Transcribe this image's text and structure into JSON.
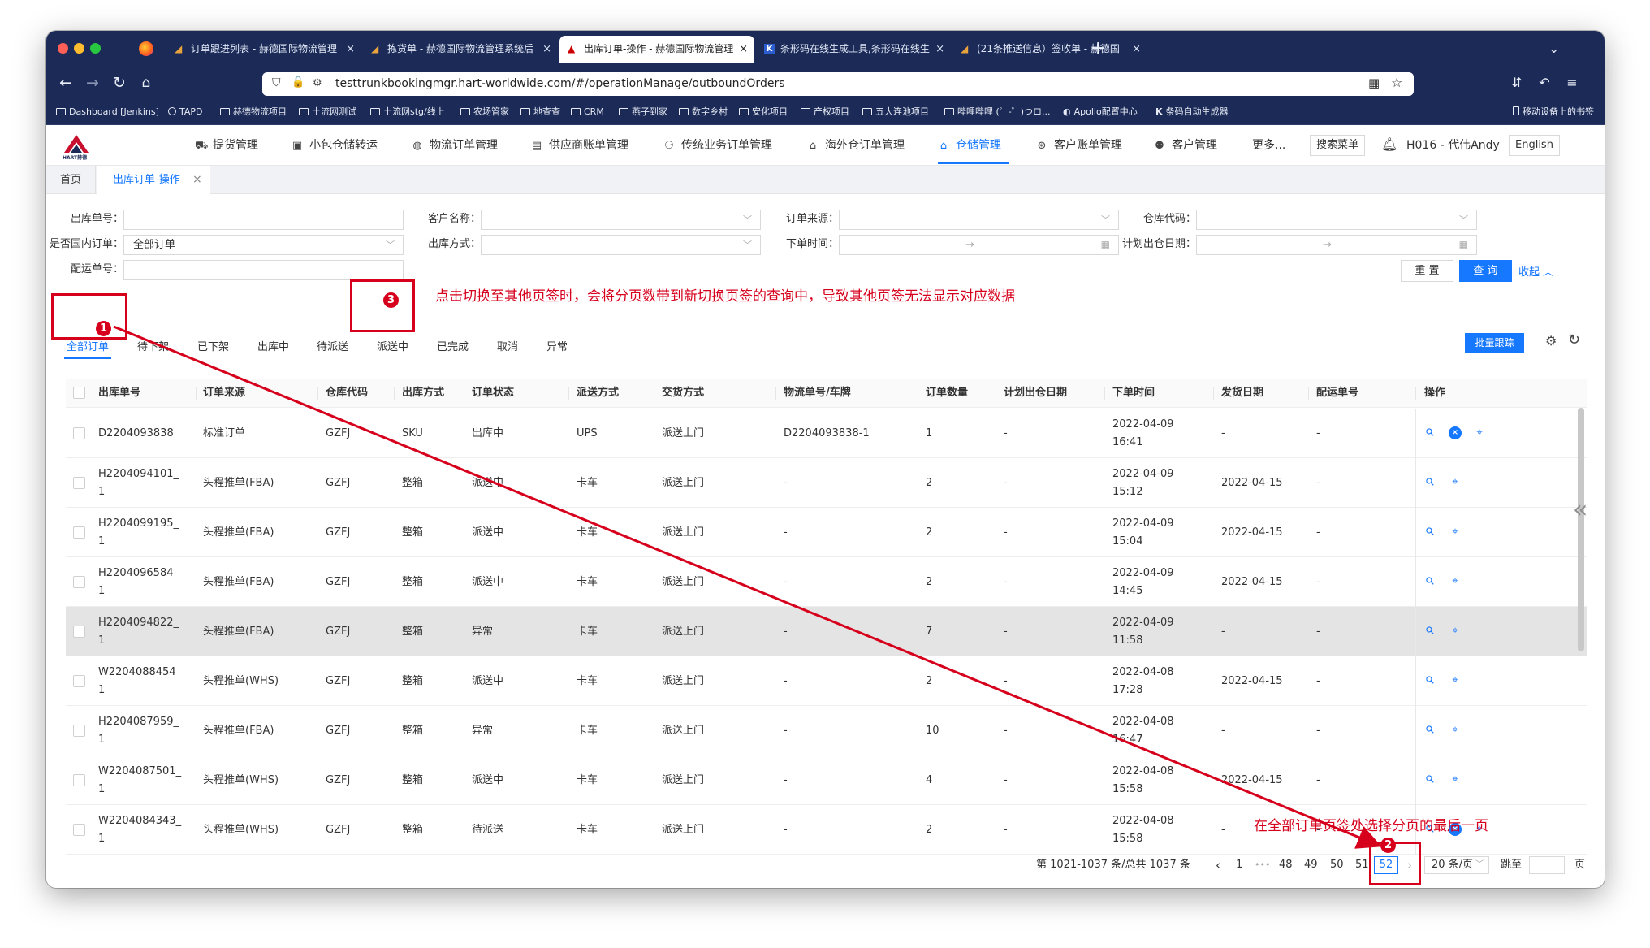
{
  "browser": {
    "tabs": [
      {
        "title": "订单跟进列表 - 赫德国际物流管理"
      },
      {
        "title": "拣货单 - 赫德国际物流管理系统后"
      },
      {
        "title": "出库订单-操作 - 赫德国际物流管理"
      },
      {
        "title": "条形码在线生成工具,条形码在线生"
      },
      {
        "title": "(21条推送信息）签收单 - 赫德国"
      }
    ],
    "url": "testtrunkbookingmgr.hart-worldwide.com/#/operationManage/outboundOrders",
    "bookmarks": [
      "Dashboard [Jenkins]",
      "TAPD",
      "赫德物流项目",
      "土流网测试",
      "土流网stg/线上",
      "农场管家",
      "地查查",
      "CRM",
      "燕子到家",
      "数字乡村",
      "安化项目",
      "产权项目",
      "五大连池项目",
      "哔哩哔哩 (゜-゜)つロ...",
      "Apollo配置中心",
      "条码自动生成器"
    ],
    "bookmarks_right": "移动设备上的书签"
  },
  "app": {
    "logo_text": "HART赫德",
    "menu": [
      "提货管理",
      "小包仓储转运",
      "物流订单管理",
      "供应商账单管理",
      "传统业务订单管理",
      "海外仓订单管理",
      "仓储管理",
      "客户账单管理",
      "客户管理"
    ],
    "more": "更多...",
    "search_menu": "搜索菜单",
    "user": "H016 - 代伟Andy",
    "language": "English"
  },
  "page_tabs": {
    "home": "首页",
    "current": "出库订单-操作"
  },
  "filters": {
    "outbound_no_label": "出库单号：",
    "customer_label": "客户名称：",
    "order_source_label": "订单来源：",
    "warehouse_label": "仓库代码：",
    "domestic_label": "是否国内订单：",
    "domestic_value": "全部订单",
    "outbound_method_label": "出库方式：",
    "order_time_label": "下单时间：",
    "plan_date_label": "计划出仓日期：",
    "delivery_no_label": "配运单号：",
    "range_arrow": "→",
    "reset": "重 置",
    "query": "查 询",
    "collapse": "收起"
  },
  "status_tabs": [
    "全部订单",
    "待下架",
    "已下架",
    "出库中",
    "待派送",
    "派送中",
    "已完成",
    "取消",
    "异常"
  ],
  "batch_track": "批量跟踪",
  "table": {
    "columns": [
      "出库单号",
      "订单来源",
      "仓库代码",
      "出库方式",
      "订单状态",
      "派送方式",
      "交货方式",
      "物流单号/车牌",
      "订单数量",
      "计划出仓日期",
      "下单时间",
      "发货日期",
      "配运单号",
      "操作"
    ],
    "rows": [
      {
        "no1": "D2204093838",
        "no2": "",
        "source": "标准订单",
        "wh": "GZFJ",
        "method": "SKU",
        "status": "出库中",
        "delivery": "UPS",
        "handover": "派送上门",
        "tracking": "D2204093838-1",
        "qty": "1",
        "plan": "-",
        "date1": "2022-04-09",
        "date2": "16:41",
        "ship": "-",
        "dist": "-"
      },
      {
        "no1": "H2204094101_",
        "no2": "1",
        "source": "头程推单(FBA)",
        "wh": "GZFJ",
        "method": "整箱",
        "status": "派送中",
        "delivery": "卡车",
        "handover": "派送上门",
        "tracking": "-",
        "qty": "2",
        "plan": "-",
        "date1": "2022-04-09",
        "date2": "15:12",
        "ship": "2022-04-15",
        "dist": "-"
      },
      {
        "no1": "H2204099195_",
        "no2": "1",
        "source": "头程推单(FBA)",
        "wh": "GZFJ",
        "method": "整箱",
        "status": "派送中",
        "delivery": "卡车",
        "handover": "派送上门",
        "tracking": "-",
        "qty": "2",
        "plan": "-",
        "date1": "2022-04-09",
        "date2": "15:04",
        "ship": "2022-04-15",
        "dist": "-"
      },
      {
        "no1": "H2204096584_",
        "no2": "1",
        "source": "头程推单(FBA)",
        "wh": "GZFJ",
        "method": "整箱",
        "status": "派送中",
        "delivery": "卡车",
        "handover": "派送上门",
        "tracking": "-",
        "qty": "2",
        "plan": "-",
        "date1": "2022-04-09",
        "date2": "14:45",
        "ship": "2022-04-15",
        "dist": "-"
      },
      {
        "no1": "H2204094822_",
        "no2": "1",
        "source": "头程推单(FBA)",
        "wh": "GZFJ",
        "method": "整箱",
        "status": "异常",
        "delivery": "卡车",
        "handover": "派送上门",
        "tracking": "-",
        "qty": "7",
        "plan": "-",
        "date1": "2022-04-09",
        "date2": "11:58",
        "ship": "-",
        "dist": "-"
      },
      {
        "no1": "W2204088454_",
        "no2": "1",
        "source": "头程推单(WHS)",
        "wh": "GZFJ",
        "method": "整箱",
        "status": "派送中",
        "delivery": "卡车",
        "handover": "派送上门",
        "tracking": "-",
        "qty": "2",
        "plan": "-",
        "date1": "2022-04-08",
        "date2": "17:28",
        "ship": "2022-04-15",
        "dist": "-"
      },
      {
        "no1": "H2204087959_",
        "no2": "1",
        "source": "头程推单(FBA)",
        "wh": "GZFJ",
        "method": "整箱",
        "status": "异常",
        "delivery": "卡车",
        "handover": "派送上门",
        "tracking": "-",
        "qty": "10",
        "plan": "-",
        "date1": "2022-04-08",
        "date2": "16:47",
        "ship": "-",
        "dist": "-"
      },
      {
        "no1": "W2204087501_",
        "no2": "1",
        "source": "头程推单(WHS)",
        "wh": "GZFJ",
        "method": "整箱",
        "status": "派送中",
        "delivery": "卡车",
        "handover": "派送上门",
        "tracking": "-",
        "qty": "4",
        "plan": "-",
        "date1": "2022-04-08",
        "date2": "15:58",
        "ship": "2022-04-15",
        "dist": "-"
      },
      {
        "no1": "W2204084343_",
        "no2": "1",
        "source": "头程推单(WHS)",
        "wh": "GZFJ",
        "method": "整箱",
        "status": "待派送",
        "delivery": "卡车",
        "handover": "派送上门",
        "tracking": "-",
        "qty": "2",
        "plan": "-",
        "date1": "2022-04-08",
        "date2": "15:58",
        "ship": "-",
        "dist": "-"
      }
    ]
  },
  "pagination": {
    "summary": "第 1021-1037 条/总共 1037 条",
    "pages": [
      "1",
      "•••",
      "48",
      "49",
      "50",
      "51",
      "52"
    ],
    "current": "52",
    "page_size": "20 条/页",
    "jump_label": "跳至",
    "page_unit": "页"
  },
  "annotations": {
    "note_top": "点击切换至其他页签时，会将分页数带到新切换页签的查询中，导致其他页签无法显示对应数据",
    "note_bottom": "在全部订单页签处选择分页的最后一页",
    "badges": [
      "1",
      "2",
      "3"
    ]
  },
  "colors": {
    "accent": "#1677ff",
    "annotation_red": "#d6001c",
    "browser_chrome": "#1b2a57"
  }
}
